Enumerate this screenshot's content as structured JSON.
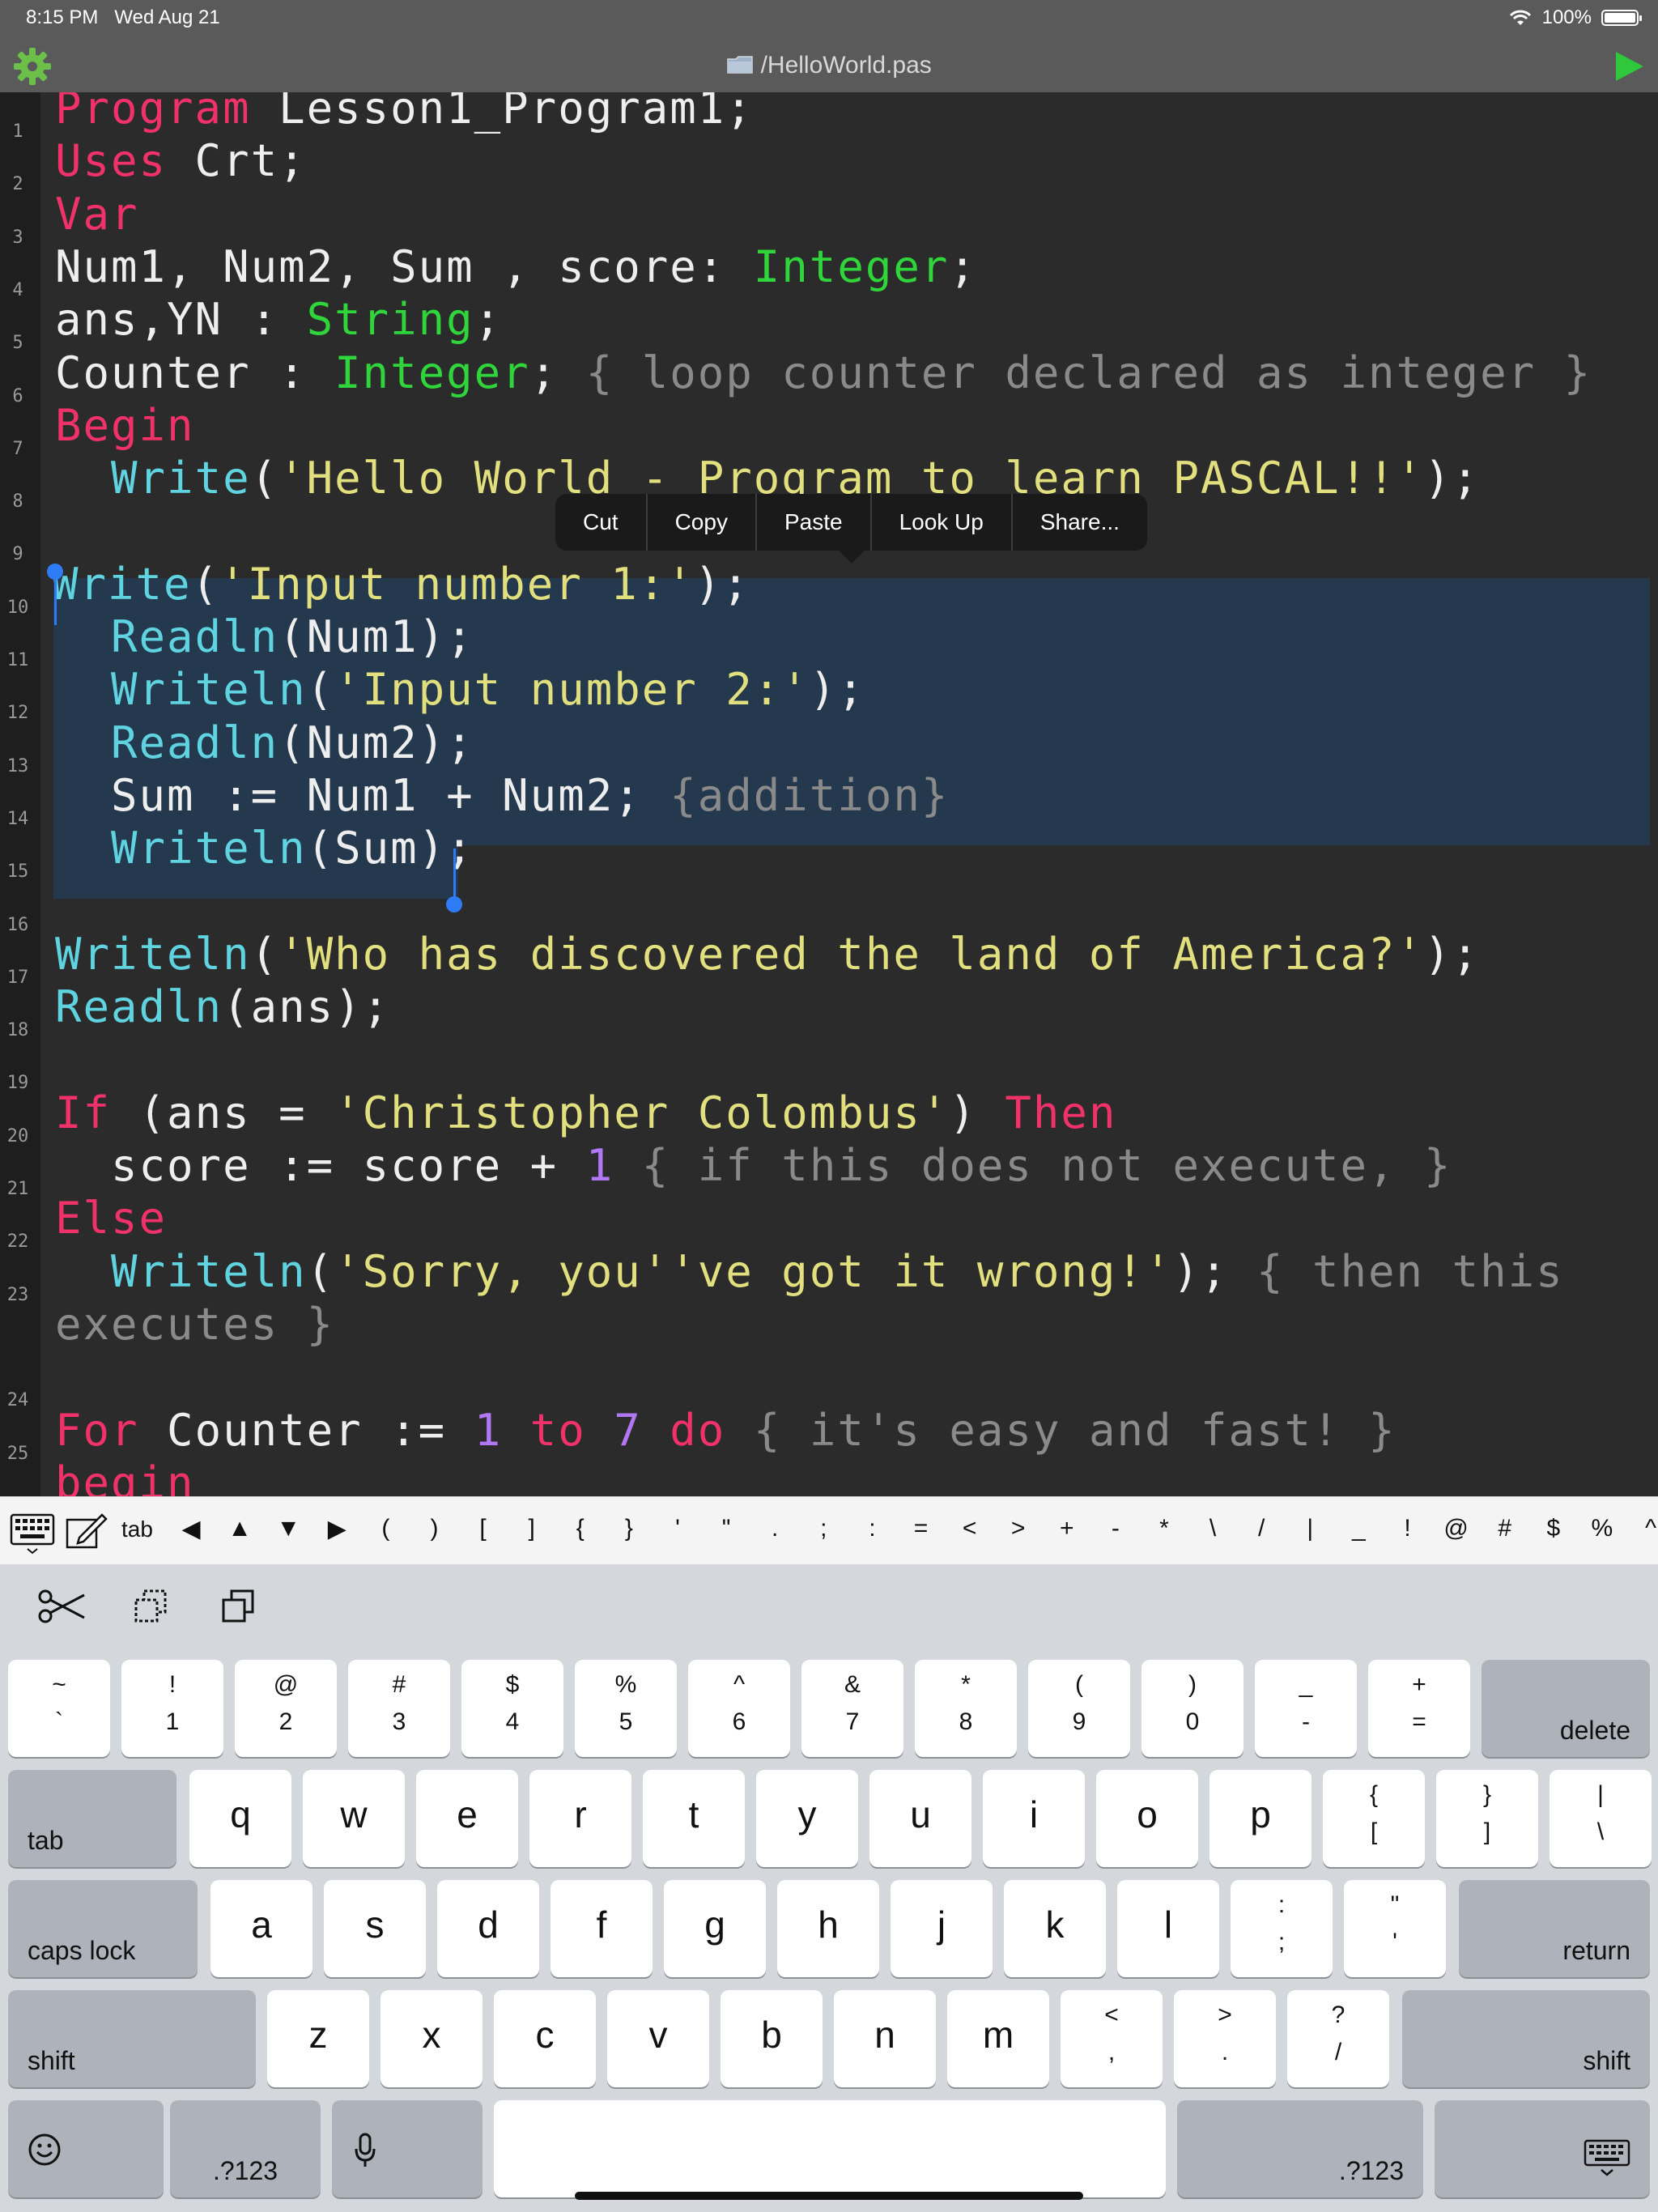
{
  "status_bar": {
    "time": "8:15 PM",
    "date": "Wed Aug 21",
    "battery": "100%"
  },
  "title_bar": {
    "title": "/HelloWorld.pas"
  },
  "code": {
    "line_numbers": [
      "1",
      "2",
      "3",
      "4",
      "5",
      "6",
      "7",
      "8",
      "9",
      "10",
      "11",
      "12",
      "13",
      "14",
      "15",
      "16",
      "17",
      "18",
      "19",
      "20",
      "21",
      "22",
      "23",
      "24",
      "25"
    ],
    "lines": [
      [
        {
          "t": "Program",
          "c": "kw"
        },
        {
          "t": " Lesson1_Program1;",
          "c": ""
        }
      ],
      [
        {
          "t": "Uses",
          "c": "kw"
        },
        {
          "t": " Crt;",
          "c": ""
        }
      ],
      [
        {
          "t": "Var",
          "c": "kw"
        }
      ],
      [
        {
          "t": "Num1, Num2, Sum , score: ",
          "c": ""
        },
        {
          "t": "Integer",
          "c": "ty"
        },
        {
          "t": ";",
          "c": ""
        }
      ],
      [
        {
          "t": "ans,YN : ",
          "c": ""
        },
        {
          "t": "String",
          "c": "ty"
        },
        {
          "t": ";",
          "c": ""
        }
      ],
      [
        {
          "t": "Counter : ",
          "c": ""
        },
        {
          "t": "Integer",
          "c": "ty"
        },
        {
          "t": "; ",
          "c": ""
        },
        {
          "t": "{ loop counter declared as integer }",
          "c": "cm"
        }
      ],
      [
        {
          "t": "Begin",
          "c": "kw"
        }
      ],
      [
        {
          "t": "  ",
          "c": ""
        },
        {
          "t": "Write",
          "c": "fn"
        },
        {
          "t": "(",
          "c": ""
        },
        {
          "t": "'Hello World - Program to learn PASCAL!!'",
          "c": "st"
        },
        {
          "t": ");",
          "c": ""
        }
      ],
      [],
      [
        {
          "t": "Write",
          "c": "fn"
        },
        {
          "t": "(",
          "c": ""
        },
        {
          "t": "'Input number 1:'",
          "c": "st"
        },
        {
          "t": ");",
          "c": ""
        }
      ],
      [
        {
          "t": "  ",
          "c": ""
        },
        {
          "t": "Readln",
          "c": "fn"
        },
        {
          "t": "(Num1);",
          "c": ""
        }
      ],
      [
        {
          "t": "  ",
          "c": ""
        },
        {
          "t": "Writeln",
          "c": "fn"
        },
        {
          "t": "(",
          "c": ""
        },
        {
          "t": "'Input number 2:'",
          "c": "st"
        },
        {
          "t": ");",
          "c": ""
        }
      ],
      [
        {
          "t": "  ",
          "c": ""
        },
        {
          "t": "Readln",
          "c": "fn"
        },
        {
          "t": "(Num2);",
          "c": ""
        }
      ],
      [
        {
          "t": "  Sum := Num1 + Num2; ",
          "c": ""
        },
        {
          "t": "{addition}",
          "c": "cm"
        }
      ],
      [
        {
          "t": "  ",
          "c": ""
        },
        {
          "t": "Writeln",
          "c": "fn"
        },
        {
          "t": "(Sum);",
          "c": ""
        }
      ],
      [],
      [
        {
          "t": "Writeln",
          "c": "fn"
        },
        {
          "t": "(",
          "c": ""
        },
        {
          "t": "'Who has discovered the land of America?'",
          "c": "st"
        },
        {
          "t": ");",
          "c": ""
        }
      ],
      [
        {
          "t": "Readln",
          "c": "fn"
        },
        {
          "t": "(ans);",
          "c": ""
        }
      ],
      [],
      [
        {
          "t": "If",
          "c": "kw"
        },
        {
          "t": " (ans = ",
          "c": ""
        },
        {
          "t": "'Christopher Colombus'",
          "c": "st"
        },
        {
          "t": ") ",
          "c": ""
        },
        {
          "t": "Then",
          "c": "kw"
        }
      ],
      [
        {
          "t": "  score := score + ",
          "c": ""
        },
        {
          "t": "1",
          "c": "nm"
        },
        {
          "t": " ",
          "c": ""
        },
        {
          "t": "{ if this does not execute, }",
          "c": "cm"
        }
      ],
      [
        {
          "t": "Else",
          "c": "kw"
        }
      ],
      [
        {
          "t": "  ",
          "c": ""
        },
        {
          "t": "Writeln",
          "c": "fn"
        },
        {
          "t": "(",
          "c": ""
        },
        {
          "t": "'Sorry, you''ve got it wrong!'",
          "c": "st"
        },
        {
          "t": "); ",
          "c": ""
        },
        {
          "t": "{ then this",
          "c": "cm"
        }
      ],
      [
        {
          "t": "executes }",
          "c": "cm"
        }
      ],
      [],
      [
        {
          "t": "For",
          "c": "kw"
        },
        {
          "t": " Counter := ",
          "c": ""
        },
        {
          "t": "1",
          "c": "nm"
        },
        {
          "t": " ",
          "c": ""
        },
        {
          "t": "to",
          "c": "kw"
        },
        {
          "t": " ",
          "c": ""
        },
        {
          "t": "7",
          "c": "nm"
        },
        {
          "t": " ",
          "c": ""
        },
        {
          "t": "do",
          "c": "kw"
        },
        {
          "t": " ",
          "c": ""
        },
        {
          "t": "{ it's easy and fast! }",
          "c": "cm"
        }
      ],
      [
        {
          "t": "begin",
          "c": "kw"
        }
      ]
    ]
  },
  "context_menu": {
    "items": [
      "Cut",
      "Copy",
      "Paste",
      "Look Up",
      "Share..."
    ]
  },
  "accessory_bar": {
    "tab_label": "tab",
    "symbols": [
      "◀",
      "▲",
      "▼",
      "▶",
      "(",
      ")",
      "[",
      "]",
      "{",
      "}",
      "'",
      "\"",
      ".",
      ";",
      ":",
      "=",
      "<",
      ">",
      "+",
      "-",
      "*",
      "\\",
      "/",
      "|",
      "_",
      "!",
      "@",
      "#",
      "$",
      "%",
      "^"
    ]
  },
  "keyboard": {
    "row1": [
      [
        "~",
        "`"
      ],
      [
        "!",
        "1"
      ],
      [
        "@",
        "2"
      ],
      [
        "#",
        "3"
      ],
      [
        "$",
        "4"
      ],
      [
        "%",
        "5"
      ],
      [
        "^",
        "6"
      ],
      [
        "&",
        "7"
      ],
      [
        "*",
        "8"
      ],
      [
        "(",
        "9"
      ],
      [
        ")",
        "0"
      ],
      [
        "_",
        "-"
      ],
      [
        "+",
        "="
      ]
    ],
    "delete": "delete",
    "tab": "tab",
    "row2": [
      "q",
      "w",
      "e",
      "r",
      "t",
      "y",
      "u",
      "i",
      "o",
      "p"
    ],
    "row2_sym": [
      [
        "{",
        "["
      ],
      [
        "}",
        "]"
      ],
      [
        "|",
        "\\"
      ]
    ],
    "caps": "caps lock",
    "row3": [
      "a",
      "s",
      "d",
      "f",
      "g",
      "h",
      "j",
      "k",
      "l"
    ],
    "row3_sym": [
      [
        ":",
        ";"
      ],
      [
        "\"",
        "'"
      ]
    ],
    "return": "return",
    "shift": "shift",
    "row4": [
      "z",
      "x",
      "c",
      "v",
      "b",
      "n",
      "m"
    ],
    "row4_sym": [
      [
        "<",
        ","
      ],
      [
        ">",
        "."
      ],
      [
        "?",
        "/"
      ]
    ],
    "num_label": ".?123"
  },
  "colors": {
    "keyword": "#f1326a",
    "type": "#2fd53b",
    "function": "#5fd4e0",
    "string": "#e2e07e",
    "comment": "#8a8a8a",
    "number": "#b277f4",
    "selection": "#24384e"
  }
}
